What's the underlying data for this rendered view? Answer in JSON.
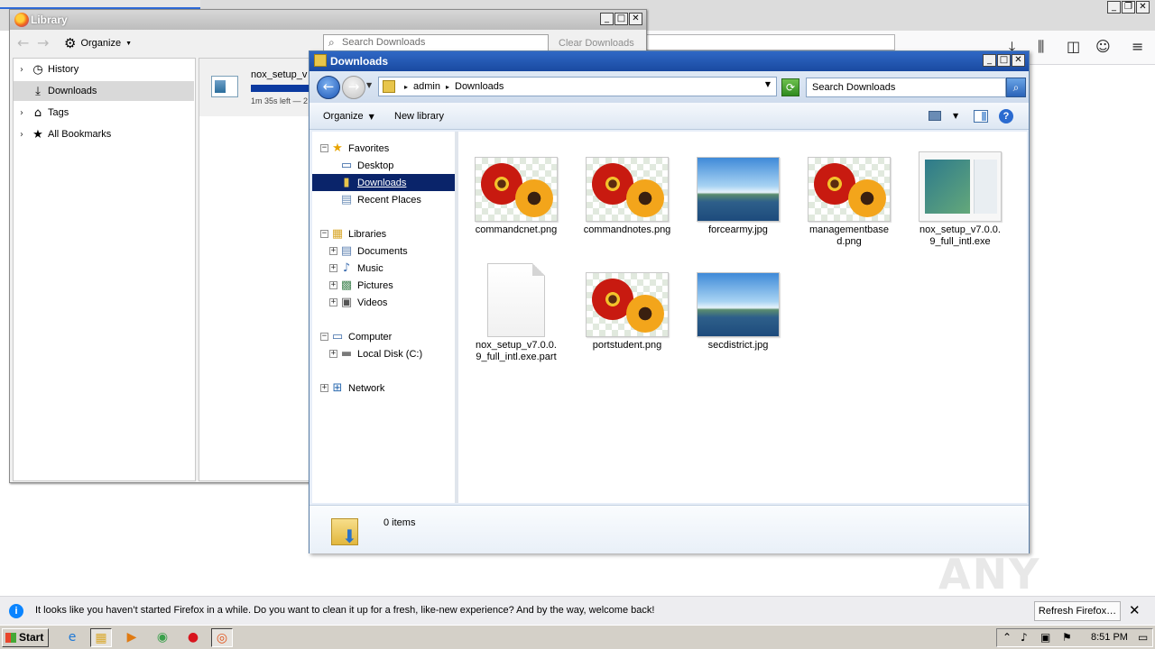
{
  "library": {
    "title": "Library",
    "organize_label": "Organize",
    "search_placeholder": "Search Downloads",
    "clear_label": "Clear Downloads",
    "tree": [
      {
        "label": "History"
      },
      {
        "label": "Downloads"
      },
      {
        "label": "Tags"
      },
      {
        "label": "All Bookmarks"
      }
    ],
    "download": {
      "name": "nox_setup_v",
      "status": "1m 35s left — 2"
    }
  },
  "explorer": {
    "title": "Downloads",
    "breadcrumb": [
      "admin",
      "Downloads"
    ],
    "search_placeholder": "Search Downloads",
    "commands": {
      "organize": "Organize",
      "new_library": "New library"
    },
    "nav": {
      "favorites": "Favorites",
      "desktop": "Desktop",
      "downloads": "Downloads",
      "recent_places": "Recent Places",
      "libraries": "Libraries",
      "documents": "Documents",
      "music": "Music",
      "pictures": "Pictures",
      "videos": "Videos",
      "computer": "Computer",
      "local_disk": "Local Disk (C:)",
      "network": "Network"
    },
    "files": [
      {
        "name": "commandcnet.png",
        "kind": "flower-image"
      },
      {
        "name": "commandnotes.png",
        "kind": "flower-image"
      },
      {
        "name": "forcearmy.jpg",
        "kind": "landscape-image"
      },
      {
        "name": "managementbased.png",
        "kind": "flower-image"
      },
      {
        "name": "nox_setup_v7.0.0.9_full_intl.exe",
        "kind": "application"
      },
      {
        "name": "nox_setup_v7.0.0.9_full_intl.exe.part",
        "kind": "blank-file"
      },
      {
        "name": "portstudent.png",
        "kind": "flower-image"
      },
      {
        "name": "secdistrict.jpg",
        "kind": "landscape-image"
      }
    ],
    "details": {
      "items_text": "0 items"
    }
  },
  "notification": {
    "text": "It looks like you haven’t started Firefox in a while. Do you want to clean it up for a fresh, like-new experience? And by the way, welcome back!",
    "button": "Refresh Firefox…"
  },
  "taskbar": {
    "start_label": "Start",
    "clock": "8:51 PM"
  },
  "watermark": "ANY RUN"
}
